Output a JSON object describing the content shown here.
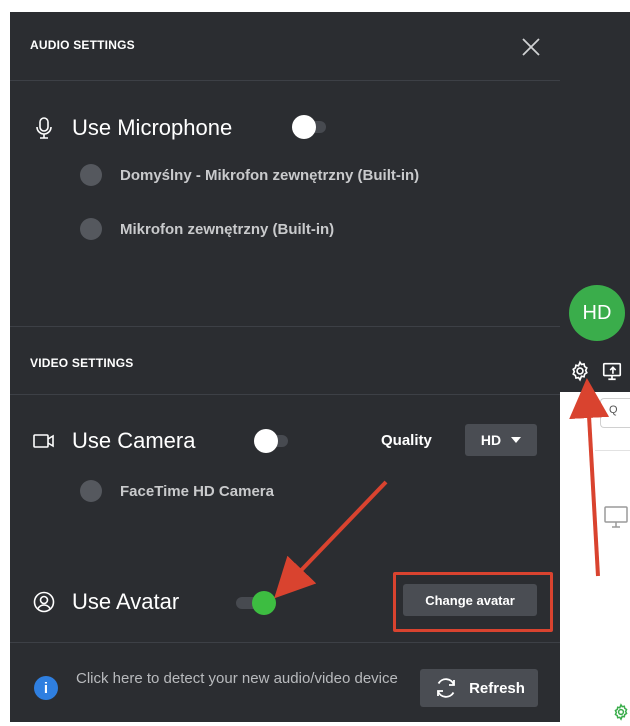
{
  "audio": {
    "title": "AUDIO SETTINGS",
    "use_microphone_label": "Use Microphone",
    "microphone_enabled": false,
    "devices": [
      "Domyślny - Mikrofon zewnętrzny (Built-in)",
      "Mikrofon zewnętrzny (Built-in)"
    ]
  },
  "video": {
    "title": "VIDEO SETTINGS",
    "use_camera_label": "Use Camera",
    "camera_enabled": false,
    "quality_label": "Quality",
    "quality_value": "HD",
    "devices": [
      "FaceTime HD Camera"
    ],
    "use_avatar_label": "Use Avatar",
    "avatar_enabled": true,
    "change_avatar_label": "Change avatar"
  },
  "footer": {
    "detect_text": "Click here to detect your new audio/video device",
    "refresh_label": "Refresh"
  },
  "sidebar": {
    "avatar_initials": "HD",
    "search_glyph": "Q"
  },
  "colors": {
    "panel_bg": "#2b2d31",
    "toggle_on": "#3dbd41",
    "avatar_bg": "#3aad4b",
    "info_blue": "#2f7fe0",
    "annotation_red": "#d9432f"
  },
  "icons": [
    "close-icon",
    "microphone-icon",
    "camera-icon",
    "avatar-icon",
    "info-icon",
    "refresh-icon",
    "gear-icon",
    "share-screen-icon",
    "monitor-icon"
  ]
}
